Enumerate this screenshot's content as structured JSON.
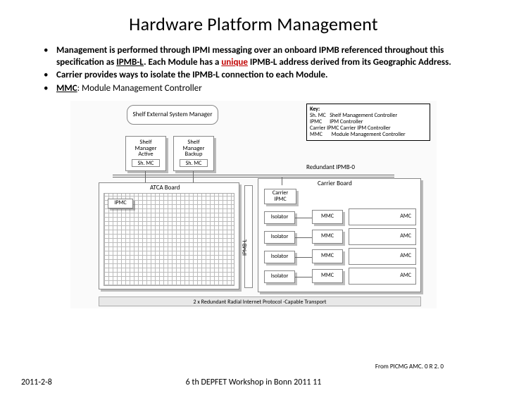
{
  "title": "Hardware Platform Management",
  "bullets": [
    {
      "pre": "Management is performed through IPMI messaging over an onboard IPMB referenced throughout this specification as ",
      "u1": "IPMB-L",
      "mid1": ". Each Module has a ",
      "red": "unique",
      "mid2": " IPMB-L address derived from its Geographic Address."
    },
    {
      "plain": "Carrier provides ways to isolate the IPMB-L connection to each Module."
    },
    {
      "pre": "MMC",
      "norm": ": Module Management Controller"
    }
  ],
  "diagram": {
    "ext_mgr": "Shelf External System\nManager",
    "shelf_mgr_active_top": "Shelf\nManager\nActive",
    "shelf_mgr_backup_top": "Shelf\nManager\nBackup",
    "shmc": "Sh. MC",
    "atca_board": "ATCA  Board",
    "ipmc": "IPMC",
    "ipmb_l": "IPMB-L",
    "carrier_board": "Carrier Board",
    "carrier_ipmc": "Carrier\nIPMC",
    "isolator": "Isolator",
    "mmc": "MMC",
    "amc": "AMC",
    "redundant_ipmb0": "Redundant  IPMB-0",
    "transport": "2 x Redundant Radial Internet Protocol  -Capable Transport",
    "key": {
      "title": "Key:",
      "rows": [
        [
          "Sh. MC",
          "Shelf Management Controller"
        ],
        [
          "IPMC",
          "IPM Controller"
        ],
        [
          "Carrier IPMC",
          "Carrier IPM Controller"
        ],
        [
          "MMC",
          "Module Management Controller"
        ]
      ]
    }
  },
  "caption": "From PICMG AMC. 0 R 2. 0",
  "footer_center": "6 th DEPFET Workshop in Bonn 2011   11",
  "date": "2011-2-8"
}
